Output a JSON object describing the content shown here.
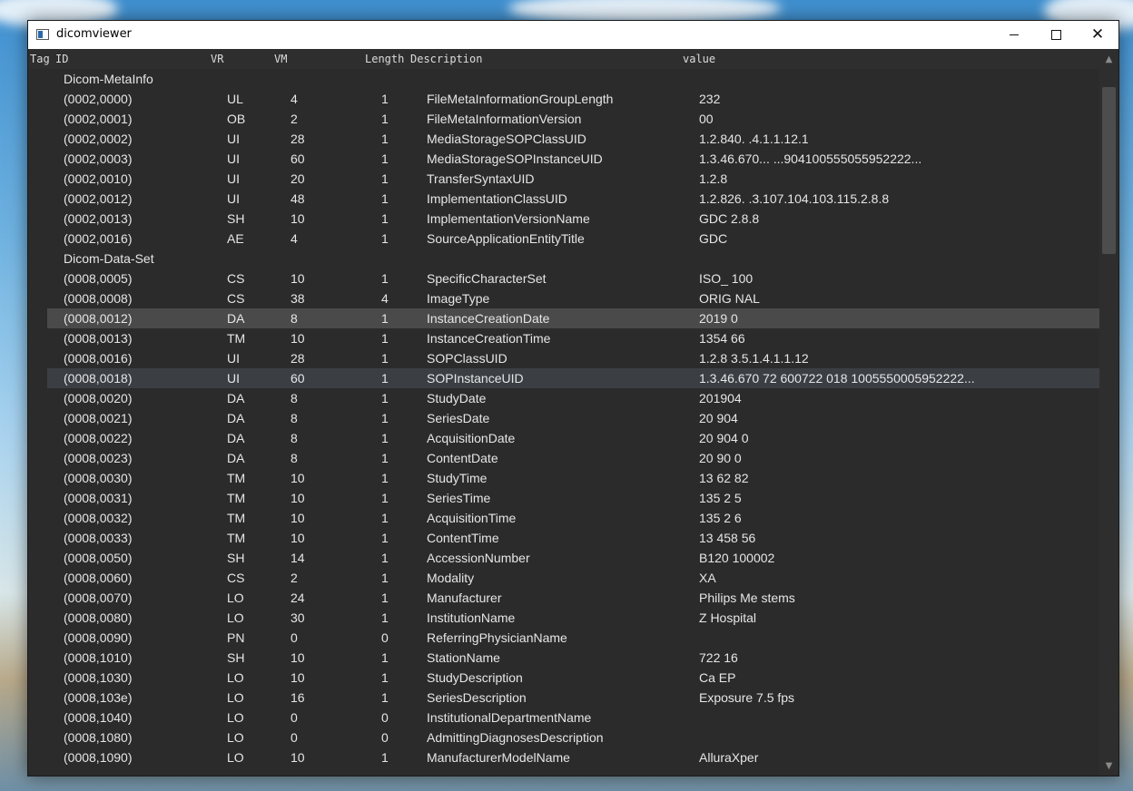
{
  "window": {
    "title": "dicomviewer"
  },
  "header": {
    "tag": "Tag",
    "id": "ID",
    "vr": "VR",
    "vm": "VM",
    "length": "Length",
    "description": "Description",
    "value": "value"
  },
  "rows": [
    {
      "type": "group",
      "label": "Dicom-MetaInfo"
    },
    {
      "id": "(0002,0000)",
      "vr": "UL",
      "vm": "4",
      "len": "1",
      "desc": "FileMetaInformationGroupLength",
      "val": "232"
    },
    {
      "id": "(0002,0001)",
      "vr": "OB",
      "vm": "2",
      "len": "1",
      "desc": "FileMetaInformationVersion",
      "val": "00"
    },
    {
      "id": "(0002,0002)",
      "vr": "UI",
      "vm": "28",
      "len": "1",
      "desc": "MediaStorageSOPClassUID",
      "val": "1.2.840.          .4.1.1.12.1"
    },
    {
      "id": "(0002,0003)",
      "vr": "UI",
      "vm": "60",
      "len": "1",
      "desc": "MediaStorageSOPInstanceUID",
      "val": "1.3.46.670...                  ...904100555055952222..."
    },
    {
      "id": "(0002,0010)",
      "vr": "UI",
      "vm": "20",
      "len": "1",
      "desc": "TransferSyntaxUID",
      "val": "1.2.8"
    },
    {
      "id": "(0002,0012)",
      "vr": "UI",
      "vm": "48",
      "len": "1",
      "desc": "ImplementationClassUID",
      "val": "1.2.826.            .3.107.104.103.115.2.8.8"
    },
    {
      "id": "(0002,0013)",
      "vr": "SH",
      "vm": "10",
      "len": "1",
      "desc": "ImplementationVersionName",
      "val": "GDC  2.8.8"
    },
    {
      "id": "(0002,0016)",
      "vr": "AE",
      "vm": "4",
      "len": "1",
      "desc": "SourceApplicationEntityTitle",
      "val": "GDC"
    },
    {
      "type": "group",
      "label": "Dicom-Data-Set"
    },
    {
      "id": "(0008,0005)",
      "vr": "CS",
      "vm": "10",
      "len": "1",
      "desc": "SpecificCharacterSet",
      "val": "ISO_  100"
    },
    {
      "id": "(0008,0008)",
      "vr": "CS",
      "vm": "38",
      "len": "4",
      "desc": "ImageType",
      "val": "ORIG  NAL"
    },
    {
      "id": "(0008,0012)",
      "vr": "DA",
      "vm": "8",
      "len": "1",
      "desc": "InstanceCreationDate",
      "val": "2019   0",
      "state": "highlight"
    },
    {
      "id": "(0008,0013)",
      "vr": "TM",
      "vm": "10",
      "len": "1",
      "desc": "InstanceCreationTime",
      "val": "1354   66"
    },
    {
      "id": "(0008,0016)",
      "vr": "UI",
      "vm": "28",
      "len": "1",
      "desc": "SOPClassUID",
      "val": "1.2.8   3.5.1.4.1.1.12"
    },
    {
      "id": "(0008,0018)",
      "vr": "UI",
      "vm": "60",
      "len": "1",
      "desc": "SOPInstanceUID",
      "val": "1.3.46.670          72    600722   018    1005550005952222...",
      "state": "selected"
    },
    {
      "id": "(0008,0020)",
      "vr": "DA",
      "vm": "8",
      "len": "1",
      "desc": "StudyDate",
      "val": "201904"
    },
    {
      "id": "(0008,0021)",
      "vr": "DA",
      "vm": "8",
      "len": "1",
      "desc": "SeriesDate",
      "val": "20 904"
    },
    {
      "id": "(0008,0022)",
      "vr": "DA",
      "vm": "8",
      "len": "1",
      "desc": "AcquisitionDate",
      "val": "20 904 0"
    },
    {
      "id": "(0008,0023)",
      "vr": "DA",
      "vm": "8",
      "len": "1",
      "desc": "ContentDate",
      "val": "20 90  0"
    },
    {
      "id": "(0008,0030)",
      "vr": "TM",
      "vm": "10",
      "len": "1",
      "desc": "StudyTime",
      "val": "13 62  82"
    },
    {
      "id": "(0008,0031)",
      "vr": "TM",
      "vm": "10",
      "len": "1",
      "desc": "SeriesTime",
      "val": "135  2 5"
    },
    {
      "id": "(0008,0032)",
      "vr": "TM",
      "vm": "10",
      "len": "1",
      "desc": "AcquisitionTime",
      "val": "135  2 6"
    },
    {
      "id": "(0008,0033)",
      "vr": "TM",
      "vm": "10",
      "len": "1",
      "desc": "ContentTime",
      "val": "13 458 56"
    },
    {
      "id": "(0008,0050)",
      "vr": "SH",
      "vm": "14",
      "len": "1",
      "desc": "AccessionNumber",
      "val": "B120    100002"
    },
    {
      "id": "(0008,0060)",
      "vr": "CS",
      "vm": "2",
      "len": "1",
      "desc": "Modality",
      "val": "XA"
    },
    {
      "id": "(0008,0070)",
      "vr": "LO",
      "vm": "24",
      "len": "1",
      "desc": "Manufacturer",
      "val": "Philips Me       stems"
    },
    {
      "id": "(0008,0080)",
      "vr": "LO",
      "vm": "30",
      "len": "1",
      "desc": "InstitutionName",
      "val": "Z              Hospital"
    },
    {
      "id": "(0008,0090)",
      "vr": "PN",
      "vm": "0",
      "len": "0",
      "desc": "ReferringPhysicianName",
      "val": ""
    },
    {
      "id": "(0008,1010)",
      "vr": "SH",
      "vm": "10",
      "len": "1",
      "desc": "StationName",
      "val": "722    16"
    },
    {
      "id": "(0008,1030)",
      "vr": "LO",
      "vm": "10",
      "len": "1",
      "desc": "StudyDescription",
      "val": "Ca    EP"
    },
    {
      "id": "(0008,103e)",
      "vr": "LO",
      "vm": "16",
      "len": "1",
      "desc": "SeriesDescription",
      "val": "Exposure 7.5 fps"
    },
    {
      "id": "(0008,1040)",
      "vr": "LO",
      "vm": "0",
      "len": "0",
      "desc": "InstitutionalDepartmentName",
      "val": ""
    },
    {
      "id": "(0008,1080)",
      "vr": "LO",
      "vm": "0",
      "len": "0",
      "desc": "AdmittingDiagnosesDescription",
      "val": ""
    },
    {
      "id": "(0008,1090)",
      "vr": "LO",
      "vm": "10",
      "len": "1",
      "desc": "ManufacturerModelName",
      "val": "AlluraXper"
    }
  ]
}
